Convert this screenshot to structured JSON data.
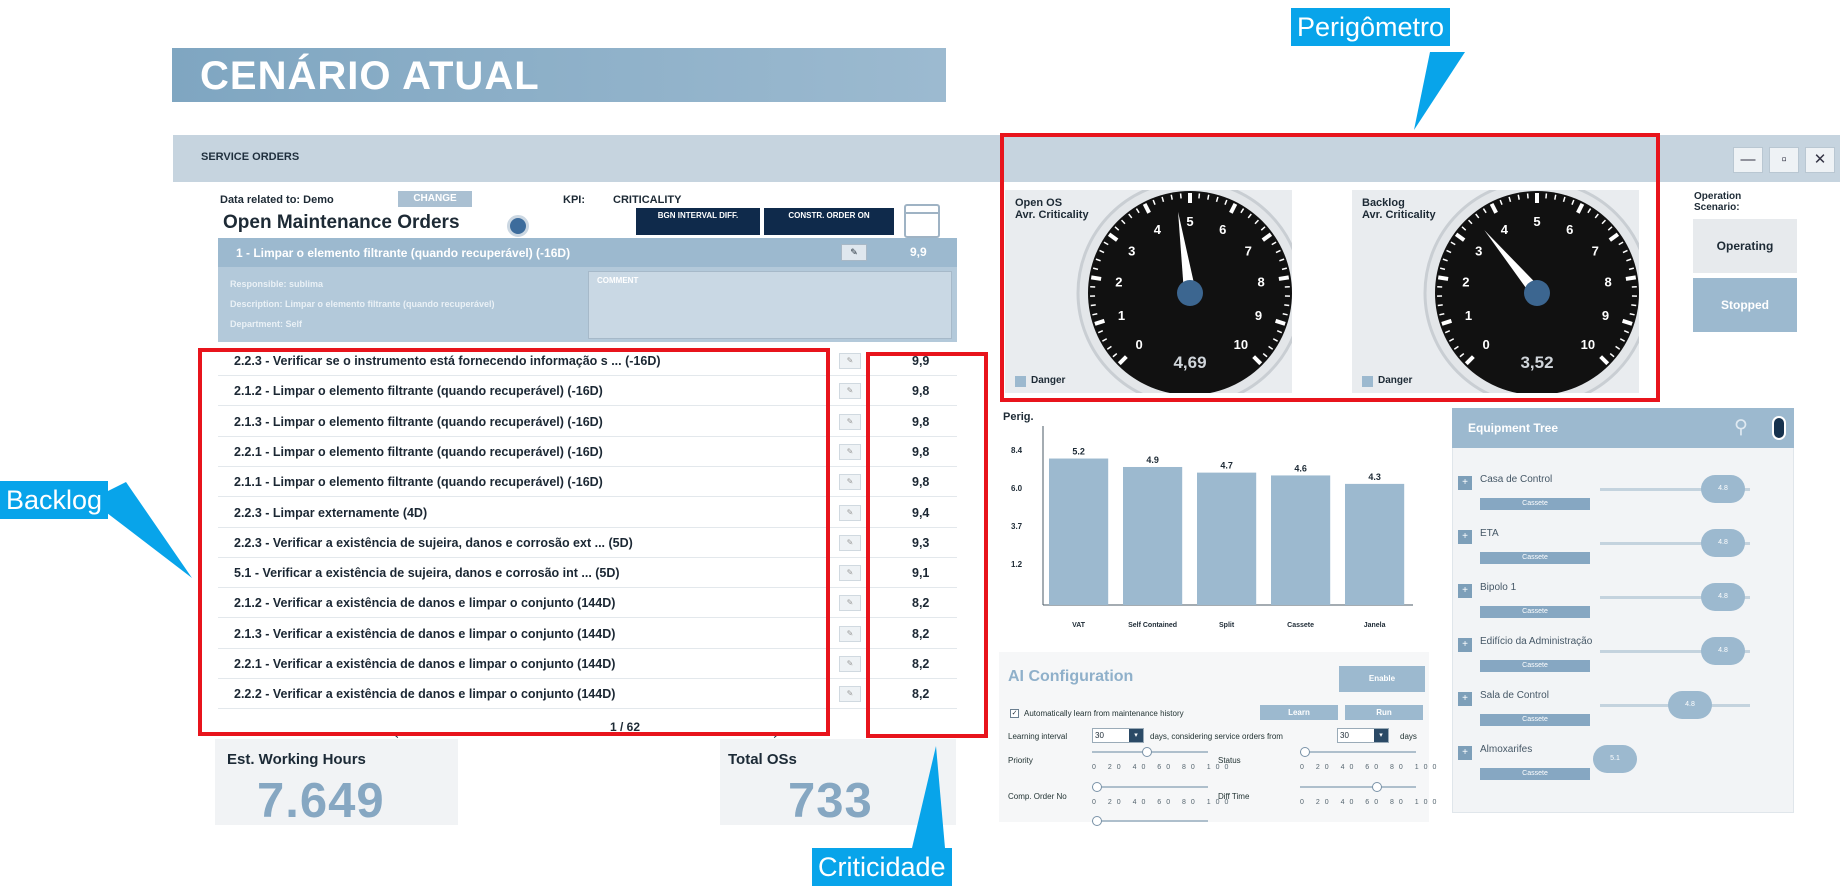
{
  "banner": {
    "title": "CENÁRIO ATUAL"
  },
  "window": {
    "title": "SERVICE ORDERS",
    "min": "—",
    "max": "▫",
    "close": "✕"
  },
  "filter": {
    "data_related": "Data related to: Demo",
    "change": "CHANGE",
    "kpi_label": "KPI:",
    "kpi_value": "CRITICALITY"
  },
  "orders": {
    "title": "Open Maintenance Orders",
    "btn_interval": "BGN INTERVAL DIFF.",
    "btn_order": "CONSTR. ORDER ON",
    "selected": {
      "title": "1 - Limpar o elemento filtrante (quando recuperável) (-16D)",
      "value": "9,9",
      "responsible": "Responsible: sublima",
      "description": "Description: Limpar o elemento filtrante (quando recuperável)",
      "department": "Department: Self",
      "comments": "COMMENT"
    },
    "rows": [
      {
        "text": "2.2.3 - Verificar se o instrumento está fornecendo informação s ... (-16D)",
        "value": "9,9"
      },
      {
        "text": "2.1.2 - Limpar o elemento filtrante (quando recuperável) (-16D)",
        "value": "9,8"
      },
      {
        "text": "2.1.3 - Limpar o elemento filtrante (quando recuperável) (-16D)",
        "value": "9,8"
      },
      {
        "text": "2.2.1 - Limpar o elemento filtrante (quando recuperável) (-16D)",
        "value": "9,8"
      },
      {
        "text": "2.1.1 - Limpar o elemento filtrante (quando recuperável) (-16D)",
        "value": "9,8"
      },
      {
        "text": "2.2.3 - Limpar externamente (4D)",
        "value": "9,4"
      },
      {
        "text": "2.2.3 - Verificar a existência de sujeira, danos e corrosão ext ... (5D)",
        "value": "9,3"
      },
      {
        "text": "5.1 - Verificar a existência de sujeira, danos e corrosão int ... (5D)",
        "value": "9,1"
      },
      {
        "text": "2.1.2 - Verificar a existência de danos e limpar o conjunto (144D)",
        "value": "8,2"
      },
      {
        "text": "2.1.3 - Verificar a existência de danos e limpar o conjunto (144D)",
        "value": "8,2"
      },
      {
        "text": "2.2.1 - Verificar a existência de danos e limpar o conjunto (144D)",
        "value": "8,2"
      },
      {
        "text": "2.2.2 - Verificar a existência de danos e limpar o conjunto (144D)",
        "value": "8,2"
      }
    ],
    "page": "1 / 62",
    "prev": "←",
    "next": "→"
  },
  "kpis": {
    "hours_label": "Est. Working Hours",
    "hours_value": "7.649",
    "total_label": "Total OSs",
    "total_value": "733"
  },
  "gauges": [
    {
      "title1": "Open OS",
      "title2": "Avr. Criticality",
      "value": "4,69",
      "level": 4.69,
      "legend": "Danger"
    },
    {
      "title1": "Backlog",
      "title2": "Avr. Criticality",
      "value": "3,52",
      "level": 3.52,
      "legend": "Danger"
    }
  ],
  "operation": {
    "label1": "Operation",
    "label2": "Scenario:",
    "operating": "Operating",
    "stopped": "Stopped"
  },
  "chart_data": {
    "type": "bar",
    "title": "",
    "ylabel": "Perig.",
    "yticks": [
      "8.4",
      "6.0",
      "3.7",
      "1.2"
    ],
    "categories": [
      "VAT",
      "Self Contained",
      "Split",
      "Cassete",
      "Janela"
    ],
    "values": [
      5.2,
      4.9,
      4.7,
      4.6,
      4.3
    ],
    "value_labels": [
      "5.2",
      "4.9",
      "4.7",
      "4.6",
      "4.3"
    ],
    "ylim": [
      0,
      6
    ],
    "color": "#9cb9cf"
  },
  "tree": {
    "title": "Equipment Tree",
    "items": [
      {
        "name": "Casa de Control",
        "sub": "Cassete",
        "knob": "4.8",
        "pos": 0.82
      },
      {
        "name": "ETA",
        "sub": "Cassete",
        "knob": "4.8",
        "pos": 0.82
      },
      {
        "name": "Bipolo 1",
        "sub": "Cassete",
        "knob": "4.8",
        "pos": 0.82
      },
      {
        "name": "Edifício da Administração",
        "sub": "Cassete",
        "knob": "4.8",
        "pos": 0.82
      },
      {
        "name": "Sala de Control",
        "sub": "Cassete",
        "knob": "4.8",
        "pos": 0.6
      },
      {
        "name": "Almoxarifes",
        "sub": "Cassete",
        "knob": "5.1",
        "pos": 0.1
      }
    ]
  },
  "ai": {
    "title": "AI Configuration",
    "enable": "Enable",
    "auto_learn": "Automatically learn from maintenance history",
    "learn_btn": "Learn",
    "run_btn": "Run",
    "learning_interval": "Learning interval",
    "interval_val": "30",
    "interval_text": "days, considering service orders from",
    "from_val": "30",
    "days": "days",
    "priority": "Priority",
    "status": "Status",
    "comp_order": "Comp. Order No",
    "diff_time": "Diff Time",
    "scale": "0 20 40 60 80 100"
  },
  "annotations": {
    "perigometro": "Perigômetro",
    "backlog": "Backlog",
    "criticidade": "Criticidade"
  }
}
